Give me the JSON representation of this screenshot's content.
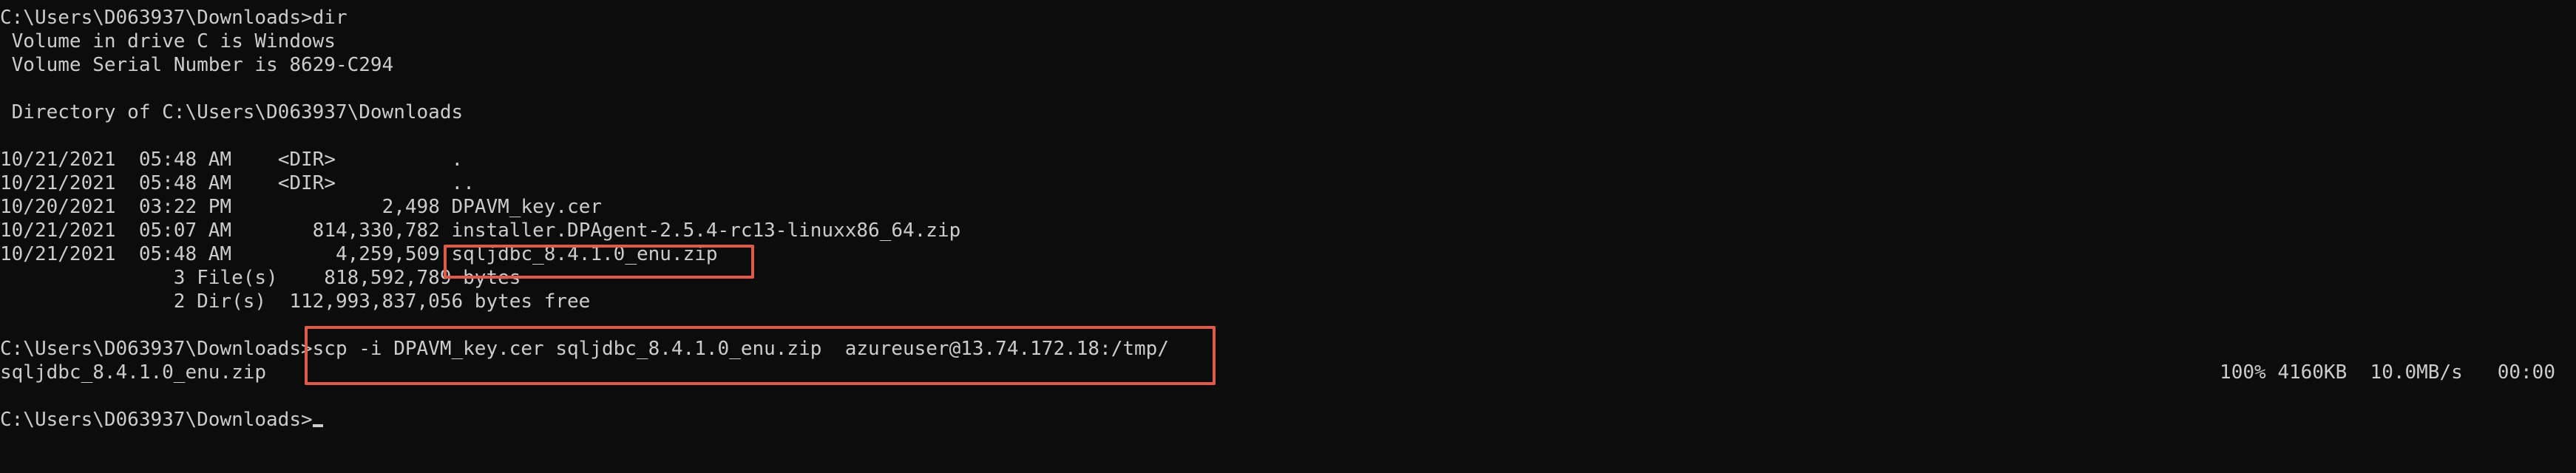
{
  "terminal": {
    "prompt": "C:\\Users\\D063937\\Downloads>",
    "commands": {
      "dir": "dir",
      "scp": "scp -i DPAVM_key.cer sqljdbc_8.4.1.0_enu.zip  azureuser@13.74.172.18:/tmp/"
    },
    "volume_line": " Volume in drive C is Windows",
    "serial_line": " Volume Serial Number is 8629-C294",
    "directory_line": " Directory of C:\\Users\\D063937\\Downloads",
    "entries": [
      {
        "date": "10/21/2021",
        "time": "05:48 AM",
        "type": "<DIR>",
        "size": "",
        "name": "."
      },
      {
        "date": "10/21/2021",
        "time": "05:48 AM",
        "type": "<DIR>",
        "size": "",
        "name": ".."
      },
      {
        "date": "10/20/2021",
        "time": "03:22 PM",
        "type": "",
        "size": "2,498",
        "name": "DPAVM_key.cer"
      },
      {
        "date": "10/21/2021",
        "time": "05:07 AM",
        "type": "",
        "size": "814,330,782",
        "name": "installer.DPAgent-2.5.4-rc13-linuxx86_64.zip"
      },
      {
        "date": "10/21/2021",
        "time": "05:48 AM",
        "type": "",
        "size": "4,259,509",
        "name": "sqljdbc_8.4.1.0_enu.zip"
      }
    ],
    "summary_files": "               3 File(s)    818,592,789 bytes",
    "summary_dirs": "               2 Dir(s)  112,993,837,056 bytes free",
    "transfer": {
      "filename": "sqljdbc_8.4.1.0_enu.zip",
      "progress": "100% 4160KB  10.0MB/s   00:00"
    }
  },
  "colors": {
    "background": "#0c0c0c",
    "text": "#cccccc",
    "highlight": "#e05a4a",
    "cursor": "#cccccc"
  }
}
